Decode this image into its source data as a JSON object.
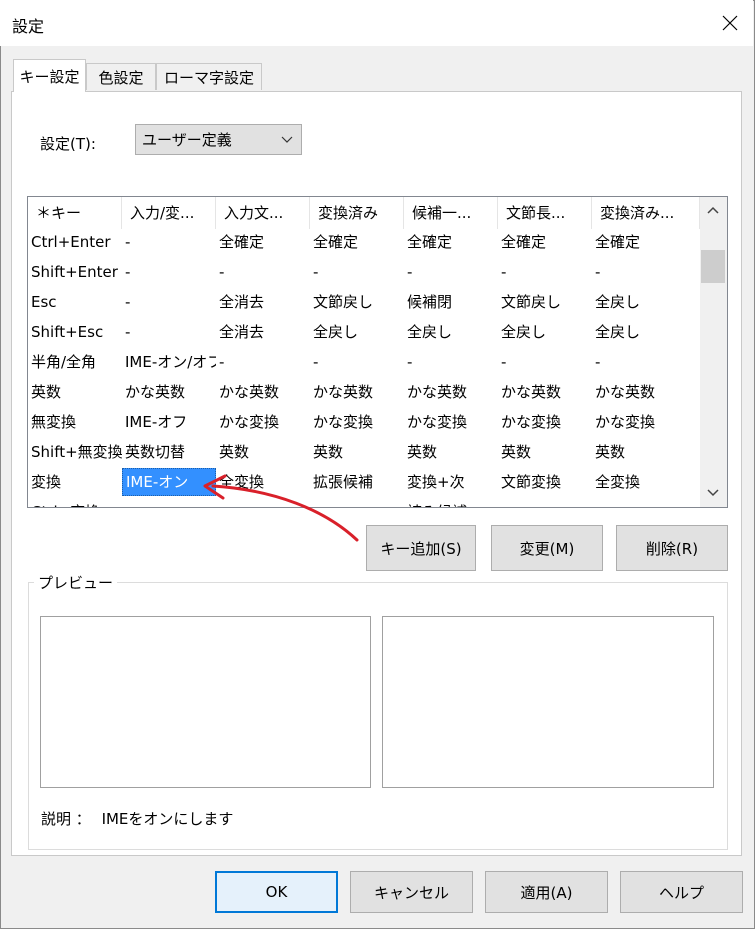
{
  "window": {
    "title": "設定"
  },
  "tabs": [
    {
      "label": "キー設定",
      "active": true
    },
    {
      "label": "色設定",
      "active": false
    },
    {
      "label": "ローマ字設定",
      "active": false
    }
  ],
  "setting": {
    "label": "設定(T):",
    "value": "ユーザー定義"
  },
  "table": {
    "headers": [
      "＊キー",
      "入力/変...",
      "入力文...",
      "変換済み",
      "候補一...",
      "文節長...",
      "変換済み..."
    ],
    "rows": [
      [
        "Ctrl+Enter",
        "-",
        "全確定",
        "全確定",
        "全確定",
        "全確定",
        "全確定"
      ],
      [
        "Shift+Enter",
        "-",
        "-",
        "-",
        "-",
        "-",
        "-"
      ],
      [
        "Esc",
        "-",
        "全消去",
        "文節戻し",
        "候補閉",
        "文節戻し",
        "全戻し"
      ],
      [
        "Shift+Esc",
        "-",
        "全消去",
        "全戻し",
        "全戻し",
        "全戻し",
        "全戻し"
      ],
      [
        "半角/全角",
        "IME-オン/オフ",
        "-",
        "-",
        "-",
        "-",
        "-"
      ],
      [
        "英数",
        "かな英数",
        "かな英数",
        "かな英数",
        "かな英数",
        "かな英数",
        "かな英数"
      ],
      [
        "無変換",
        "IME-オフ",
        "かな変換",
        "かな変換",
        "かな変換",
        "かな変換",
        "かな変換"
      ],
      [
        "Shift+無変換",
        "英数切替",
        "英数",
        "英数",
        "英数",
        "英数",
        "英数"
      ],
      [
        "変換",
        "IME-オン",
        "全変換",
        "拡張候補",
        "変換+次",
        "文節変換",
        "全変換"
      ],
      [
        "Ctrl+変換",
        "-",
        "-",
        "-",
        "読み候補",
        "-",
        "-"
      ]
    ],
    "selected": {
      "row": 8,
      "col": 1
    }
  },
  "buttons": {
    "add_key": "キー追加(S)",
    "change": "変更(M)",
    "delete": "削除(R)",
    "ok": "OK",
    "cancel": "キャンセル",
    "apply": "適用(A)",
    "help": "ヘルプ"
  },
  "preview": {
    "label": "プレビュー"
  },
  "description": {
    "label": "説明 ：",
    "text": "IMEをオンにします"
  },
  "colors": {
    "selection": "#3390ff",
    "annotation_arrow": "#d9202a",
    "ok_border": "#0078d7"
  },
  "icons": {
    "close": "close-icon",
    "dropdown": "chevron-down-icon",
    "scroll_up": "chevron-up-icon",
    "scroll_down": "chevron-down-icon"
  }
}
